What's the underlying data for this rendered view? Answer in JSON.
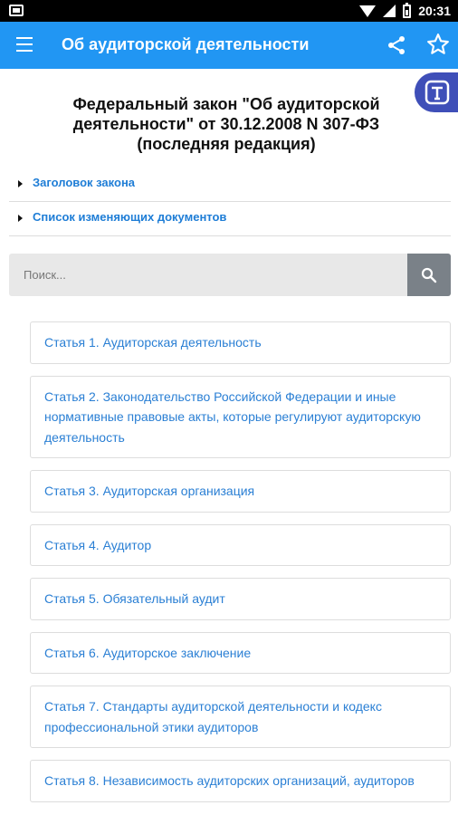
{
  "status_bar": {
    "time": "20:31",
    "icons": [
      "notification-icon",
      "wifi-icon",
      "signal-icon",
      "battery-icon"
    ]
  },
  "app_bar": {
    "title": "Об аудиторской деятельности",
    "icons": [
      "menu-icon",
      "share-icon",
      "star-icon"
    ]
  },
  "document": {
    "title": "Федеральный закон \"Об аудиторской деятельности\" от 30.12.2008 N 307-ФЗ (последняя редакция)"
  },
  "sections": [
    {
      "label": "Заголовок закона"
    },
    {
      "label": "Список изменяющих документов"
    }
  ],
  "search": {
    "placeholder": "Поиск...",
    "value": ""
  },
  "articles": [
    "Статья 1. Аудиторская деятельность",
    "Статья 2. Законодательство Российской Федерации и иные нормативные правовые акты, которые регулируют аудиторскую деятельность",
    "Статья 3. Аудиторская организация",
    "Статья 4. Аудитор",
    "Статья 5. Обязательный аудит",
    "Статья 6. Аудиторское заключение",
    "Статья 7. Стандарты аудиторской деятельности и кодекс профессиональной этики аудиторов",
    "Статья 8. Независимость аудиторских организаций, аудиторов"
  ],
  "colors": {
    "app_bar": "#2196f3",
    "link": "#2a7fd4",
    "fab": "#3f4fb8",
    "search_button": "#7a8188"
  }
}
